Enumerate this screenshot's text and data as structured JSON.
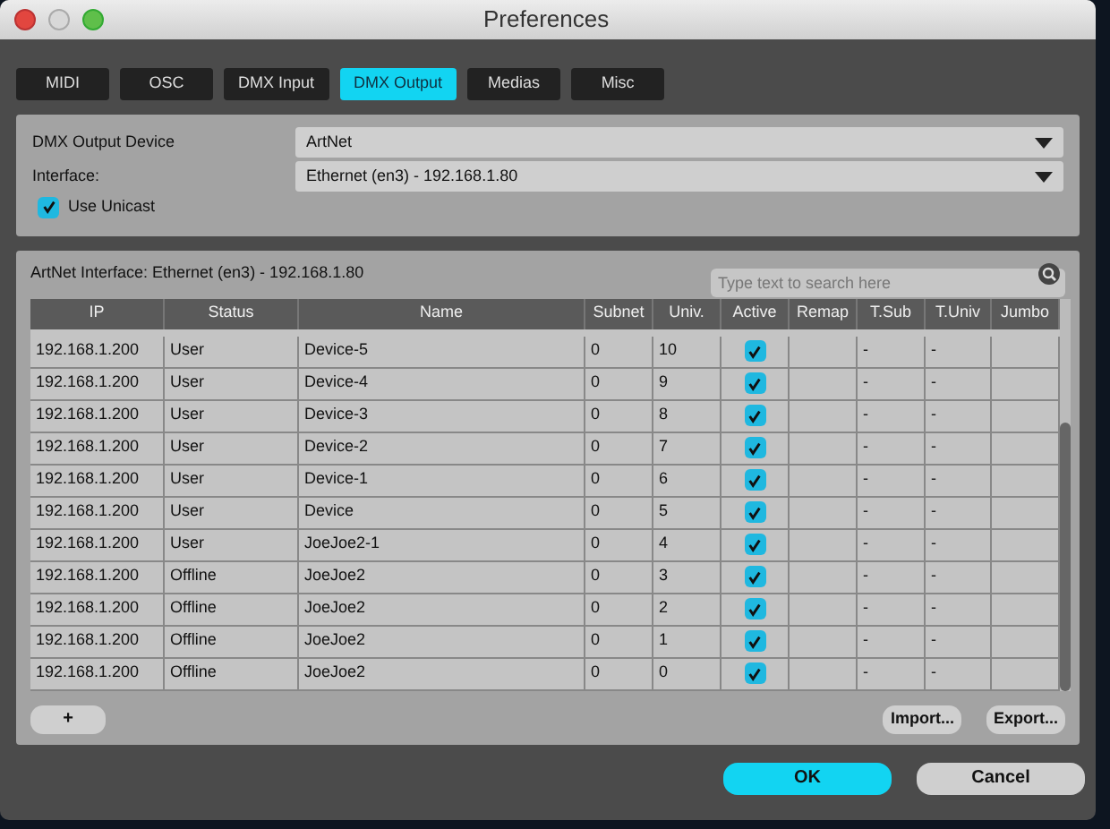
{
  "window": {
    "title": "Preferences"
  },
  "tabs": [
    {
      "label": "MIDI",
      "selected": false
    },
    {
      "label": "OSC",
      "selected": false
    },
    {
      "label": "DMX Input",
      "selected": false
    },
    {
      "label": "DMX Output",
      "selected": true
    },
    {
      "label": "Medias",
      "selected": false
    },
    {
      "label": "Misc",
      "selected": false
    }
  ],
  "device": {
    "label": "DMX Output Device",
    "value": "ArtNet"
  },
  "interface": {
    "label": "Interface:",
    "value": "Ethernet (en3) - 192.168.1.80"
  },
  "use_unicast": {
    "label": "Use Unicast",
    "checked": true
  },
  "interface_info": "ArtNet Interface: Ethernet (en3) - 192.168.1.80",
  "search": {
    "placeholder": "Type text to search here"
  },
  "table": {
    "columns": [
      "IP",
      "Status",
      "Name",
      "Subnet",
      "Univ.",
      "Active",
      "Remap",
      "T.Sub",
      "T.Univ",
      "Jumbo"
    ],
    "rows": [
      {
        "ip": "192.168.1.200",
        "status": "User",
        "name": "Device-5",
        "subnet": "0",
        "univ": "10",
        "active": true,
        "t_sub": "-",
        "t_univ": "-"
      },
      {
        "ip": "192.168.1.200",
        "status": "User",
        "name": "Device-4",
        "subnet": "0",
        "univ": "9",
        "active": true,
        "t_sub": "-",
        "t_univ": "-"
      },
      {
        "ip": "192.168.1.200",
        "status": "User",
        "name": "Device-3",
        "subnet": "0",
        "univ": "8",
        "active": true,
        "t_sub": "-",
        "t_univ": "-"
      },
      {
        "ip": "192.168.1.200",
        "status": "User",
        "name": "Device-2",
        "subnet": "0",
        "univ": "7",
        "active": true,
        "t_sub": "-",
        "t_univ": "-"
      },
      {
        "ip": "192.168.1.200",
        "status": "User",
        "name": "Device-1",
        "subnet": "0",
        "univ": "6",
        "active": true,
        "t_sub": "-",
        "t_univ": "-"
      },
      {
        "ip": "192.168.1.200",
        "status": "User",
        "name": "Device",
        "subnet": "0",
        "univ": "5",
        "active": true,
        "t_sub": "-",
        "t_univ": "-"
      },
      {
        "ip": "192.168.1.200",
        "status": "User",
        "name": "JoeJoe2-1",
        "subnet": "0",
        "univ": "4",
        "active": true,
        "t_sub": "-",
        "t_univ": "-"
      },
      {
        "ip": "192.168.1.200",
        "status": "Offline",
        "name": "JoeJoe2",
        "subnet": "0",
        "univ": "3",
        "active": true,
        "t_sub": "-",
        "t_univ": "-"
      },
      {
        "ip": "192.168.1.200",
        "status": "Offline",
        "name": "JoeJoe2",
        "subnet": "0",
        "univ": "2",
        "active": true,
        "t_sub": "-",
        "t_univ": "-"
      },
      {
        "ip": "192.168.1.200",
        "status": "Offline",
        "name": "JoeJoe2",
        "subnet": "0",
        "univ": "1",
        "active": true,
        "t_sub": "-",
        "t_univ": "-"
      },
      {
        "ip": "192.168.1.200",
        "status": "Offline",
        "name": "JoeJoe2",
        "subnet": "0",
        "univ": "0",
        "active": true,
        "t_sub": "-",
        "t_univ": "-"
      }
    ]
  },
  "table_buttons": [
    "+",
    "Import...",
    "Export..."
  ],
  "buttons": [
    {
      "label": "OK",
      "kind": "primary"
    },
    {
      "label": "Cancel",
      "kind": "secondary"
    }
  ]
}
